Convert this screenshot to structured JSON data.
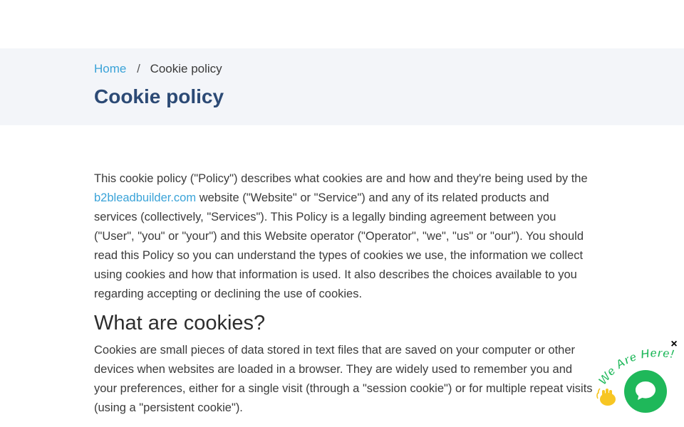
{
  "breadcrumb": {
    "home": "Home",
    "separator": "/",
    "current": "Cookie policy"
  },
  "page": {
    "title": "Cookie policy"
  },
  "content": {
    "intro_before_link": "This cookie policy (\"Policy\") describes what cookies are and how and they're being used by the ",
    "intro_link": "b2bleadbuilder.com",
    "intro_after_link": " website (\"Website\" or \"Service\") and any of its related products and services (collectively, \"Services\"). This Policy is a legally binding agreement between you (\"User\", \"you\" or \"your\") and this Website operator (\"Operator\", \"we\", \"us\" or \"our\"). You should read this Policy so you can understand the types of cookies we use, the information we collect using cookies and how that information is used. It also describes the choices available to you regarding accepting or declining the use of cookies.",
    "section_heading": "What are cookies?",
    "section_text": "Cookies are small pieces of data stored in text files that are saved on your computer or other devices when websites are loaded in a browser. They are widely used to remember you and your preferences, either for a single visit (through a \"session cookie\") or for multiple repeat visits (using a \"persistent cookie\")."
  },
  "chat_widget": {
    "tagline": "We Are Here!",
    "close_label": "×",
    "accent_color": "#1fb85a",
    "icons": [
      "wave-hand-icon",
      "chat-bubble-icon",
      "close-icon"
    ]
  },
  "colors": {
    "link": "#3aa3d8",
    "title": "#2c4a75",
    "hero_background": "#f3f5f9",
    "text": "#3b3b3b"
  }
}
